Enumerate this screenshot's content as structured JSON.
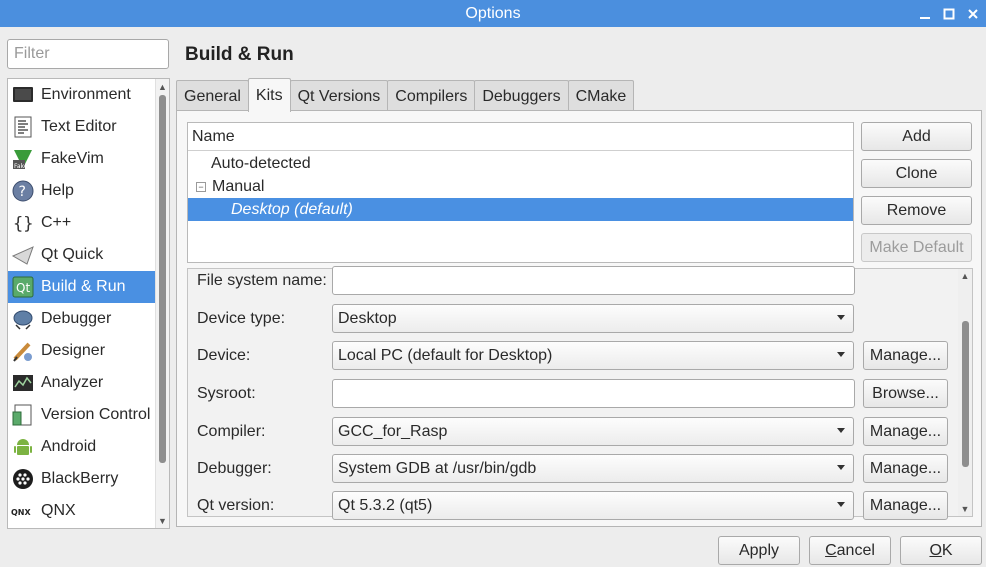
{
  "window": {
    "title": "Options"
  },
  "filter": {
    "placeholder": "Filter",
    "value": ""
  },
  "categories": [
    {
      "label": "Environment",
      "icon": "monitor-icon"
    },
    {
      "label": "Text Editor",
      "icon": "text-editor-icon"
    },
    {
      "label": "FakeVim",
      "icon": "fakevim-icon"
    },
    {
      "label": "Help",
      "icon": "help-icon"
    },
    {
      "label": "C++",
      "icon": "cpp-braces-icon"
    },
    {
      "label": "Qt Quick",
      "icon": "qt-quick-icon"
    },
    {
      "label": "Build & Run",
      "icon": "build-run-icon",
      "selected": true
    },
    {
      "label": "Debugger",
      "icon": "debugger-icon"
    },
    {
      "label": "Designer",
      "icon": "designer-icon"
    },
    {
      "label": "Analyzer",
      "icon": "analyzer-icon"
    },
    {
      "label": "Version Control",
      "icon": "version-control-icon"
    },
    {
      "label": "Android",
      "icon": "android-icon"
    },
    {
      "label": "BlackBerry",
      "icon": "blackberry-icon"
    },
    {
      "label": "QNX",
      "icon": "qnx-icon"
    }
  ],
  "page": {
    "title": "Build & Run"
  },
  "tabs": [
    {
      "label": "General"
    },
    {
      "label": "Kits",
      "active": true
    },
    {
      "label": "Qt Versions"
    },
    {
      "label": "Compilers"
    },
    {
      "label": "Debuggers"
    },
    {
      "label": "CMake"
    }
  ],
  "kits": {
    "header": "Name",
    "auto_detected": "Auto-detected",
    "manual": "Manual",
    "manual_expander": "−",
    "selected_kit": "Desktop (default)"
  },
  "kit_buttons": {
    "add": "Add",
    "clone": "Clone",
    "remove": "Remove",
    "make_default": "Make Default"
  },
  "details": {
    "fs_name_label": "File system name:",
    "fs_name_value": "",
    "device_type_label": "Device type:",
    "device_type_value": "Desktop",
    "device_label": "Device:",
    "device_value": "Local PC (default for Desktop)",
    "sysroot_label": "Sysroot:",
    "sysroot_value": "",
    "compiler_label": "Compiler:",
    "compiler_value": "GCC_for_Rasp",
    "debugger_label": "Debugger:",
    "debugger_value": "System GDB at /usr/bin/gdb",
    "qt_version_label": "Qt version:",
    "qt_version_value": "Qt 5.3.2 (qt5)",
    "manage": "Manage...",
    "browse": "Browse..."
  },
  "dialog_buttons": {
    "apply": "Apply",
    "cancel_first": "C",
    "cancel_rest": "ancel",
    "ok_first": "O",
    "ok_rest": "K"
  },
  "colors": {
    "titlebar": "#4b8fde",
    "selection": "#4a90e2"
  }
}
